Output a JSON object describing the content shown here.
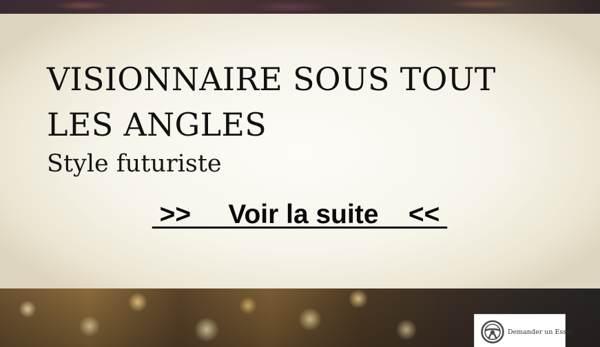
{
  "hero": {
    "title": "VISIONNAIRE SOUS TOUT LES ANGLES",
    "subtitle": "Style futuriste",
    "cta_label": " >>     Voir la suite    << "
  },
  "trial_button": {
    "label": "Demander un Essai",
    "icon": "steering-wheel-icon"
  },
  "colors": {
    "hero_background": "#f7f4ea",
    "text": "#111111"
  }
}
